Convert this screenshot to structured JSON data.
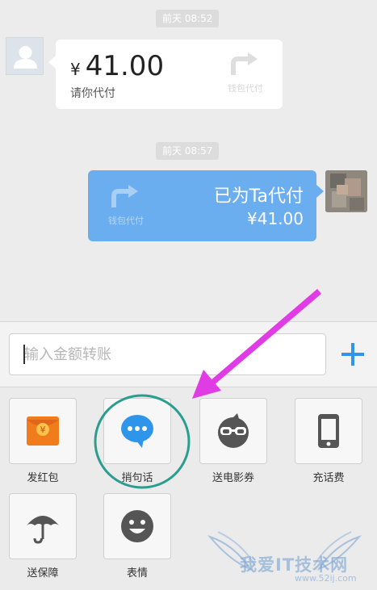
{
  "chat": {
    "time1": "前天 08:52",
    "request": {
      "currency": "¥",
      "amount": "41.00",
      "caption": "请你代付",
      "wallet_label": "钱包代付"
    },
    "time2": "前天 08:57",
    "paid": {
      "title": "已为Ta代付",
      "amount": "¥41.00",
      "wallet_label": "钱包代付"
    }
  },
  "input_bar": {
    "placeholder": "输入金额转账",
    "plus_icon": "plus-icon"
  },
  "tools": [
    {
      "label": "发红包",
      "icon": "red-packet-icon"
    },
    {
      "label": "捎句话",
      "icon": "chat-bubble-icon"
    },
    {
      "label": "送电影券",
      "icon": "movie-ticket-icon"
    },
    {
      "label": "充话费",
      "icon": "phone-icon"
    },
    {
      "label": "送保障",
      "icon": "umbrella-icon"
    },
    {
      "label": "表情",
      "icon": "smiley-icon"
    }
  ],
  "watermark": {
    "text": "我爱IT技术网",
    "site": "www.52ij.com"
  },
  "colors": {
    "accent": "#2f95ea",
    "bubble_out": "#6aaef0",
    "annotation_arrow": "#e03ce6",
    "annotation_circle": "#2a9d8f",
    "red_packet": "#f07c1c"
  }
}
